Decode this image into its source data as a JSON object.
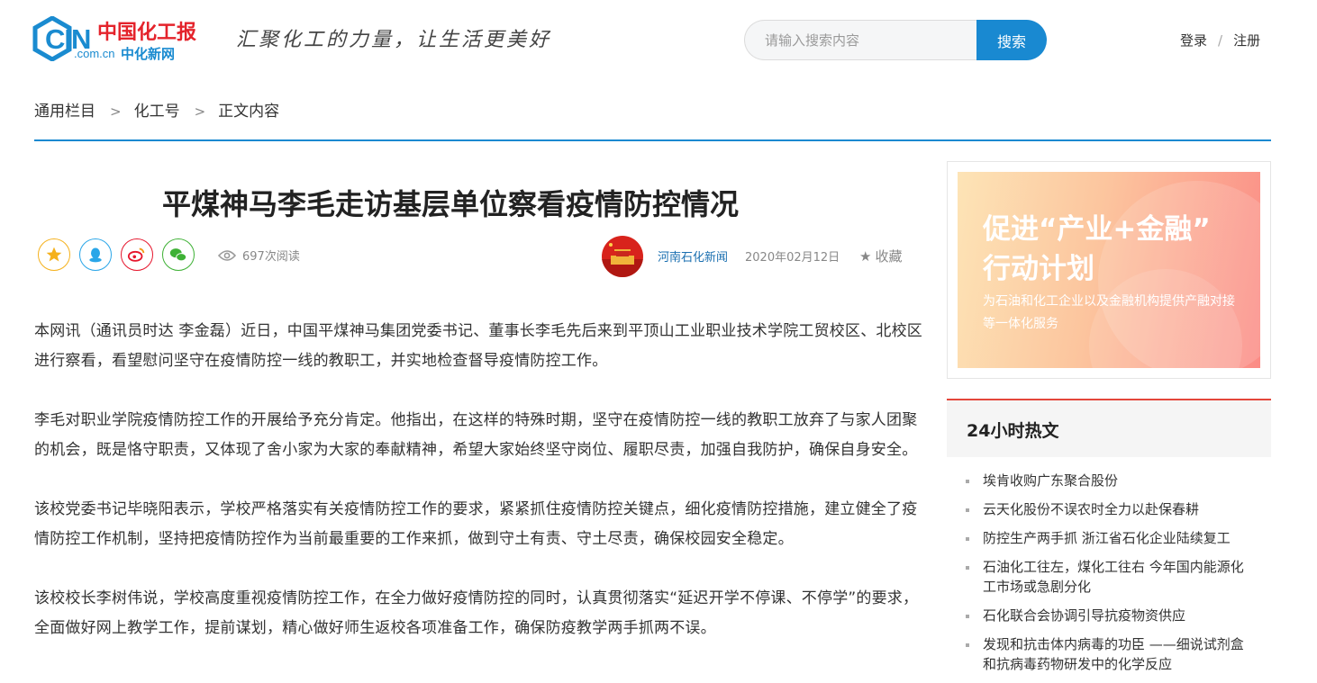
{
  "header": {
    "logo": {
      "text_cin": "CIN",
      "text_cn_red": "中国化工报",
      "text_domain": ".com.cn",
      "text_cn_blue": "中化新网"
    },
    "slogan": "汇聚化工的力量，让生活更美好",
    "search": {
      "placeholder": "请输入搜索内容",
      "button_label": "搜索"
    },
    "auth": {
      "login": "登录",
      "separator": "/",
      "register": "注册"
    }
  },
  "breadcrumb": {
    "items": [
      "通用栏目",
      "化工号",
      "正文内容"
    ],
    "separator": ">"
  },
  "article": {
    "title": "平煤神马李毛走访基层单位察看疫情防控情况",
    "views": "697次阅读",
    "share_icons": [
      "star-icon",
      "qq-icon",
      "weibo-icon",
      "wechat-icon"
    ],
    "author": "河南石化新闻",
    "date": "2020年02月12日",
    "collect_label": "收藏",
    "paragraphs": [
      "本网讯（通讯员时达 李金磊）近日，中国平煤神马集团党委书记、董事长李毛先后来到平顶山工业职业技术学院工贸校区、北校区进行察看，看望慰问坚守在疫情防控一线的教职工，并实地检查督导疫情防控工作。",
      "李毛对职业学院疫情防控工作的开展给予充分肯定。他指出，在这样的特殊时期，坚守在疫情防控一线的教职工放弃了与家人团聚的机会，既是恪守职责，又体现了舍小家为大家的奉献精神，希望大家始终坚守岗位、履职尽责，加强自我防护，确保自身安全。",
      "该校党委书记毕晓阳表示，学校严格落实有关疫情防控工作的要求，紧紧抓住疫情防控关键点，细化疫情防控措施，建立健全了疫情防控工作机制，坚持把疫情防控作为当前最重要的工作来抓，做到守土有责、守土尽责，确保校园安全稳定。",
      "该校校长李树伟说，学校高度重视疫情防控工作，在全力做好疫情防控的同时，认真贯彻落实“延迟开学不停课、不停学”的要求，全面做好网上教学工作，提前谋划，精心做好师生返校各项准备工作，确保防疫教学两手抓两不误。"
    ]
  },
  "sidebar": {
    "ad": {
      "line1": "促进“产业+金融”",
      "line2": "行动计划",
      "desc": "为石油和化工企业以及金融机构提供产融对接等一体化服务"
    },
    "hot": {
      "title": "24小时热文",
      "items": [
        "埃肯收购广东聚合股份",
        "云天化股份不误农时全力以赴保春耕",
        "防控生产两手抓 浙江省石化企业陆续复工",
        "石油化工往左，煤化工往右 今年国内能源化工市场或急剧分化",
        "石化联合会协调引导抗疫物资供应",
        "发现和抗击体内病毒的功臣 ——细说试剂盒和抗病毒药物研发中的化学反应"
      ]
    }
  },
  "colors": {
    "brand_blue": "#1989d1",
    "brand_red": "#e4232b",
    "hot_accent": "#e4473b"
  }
}
